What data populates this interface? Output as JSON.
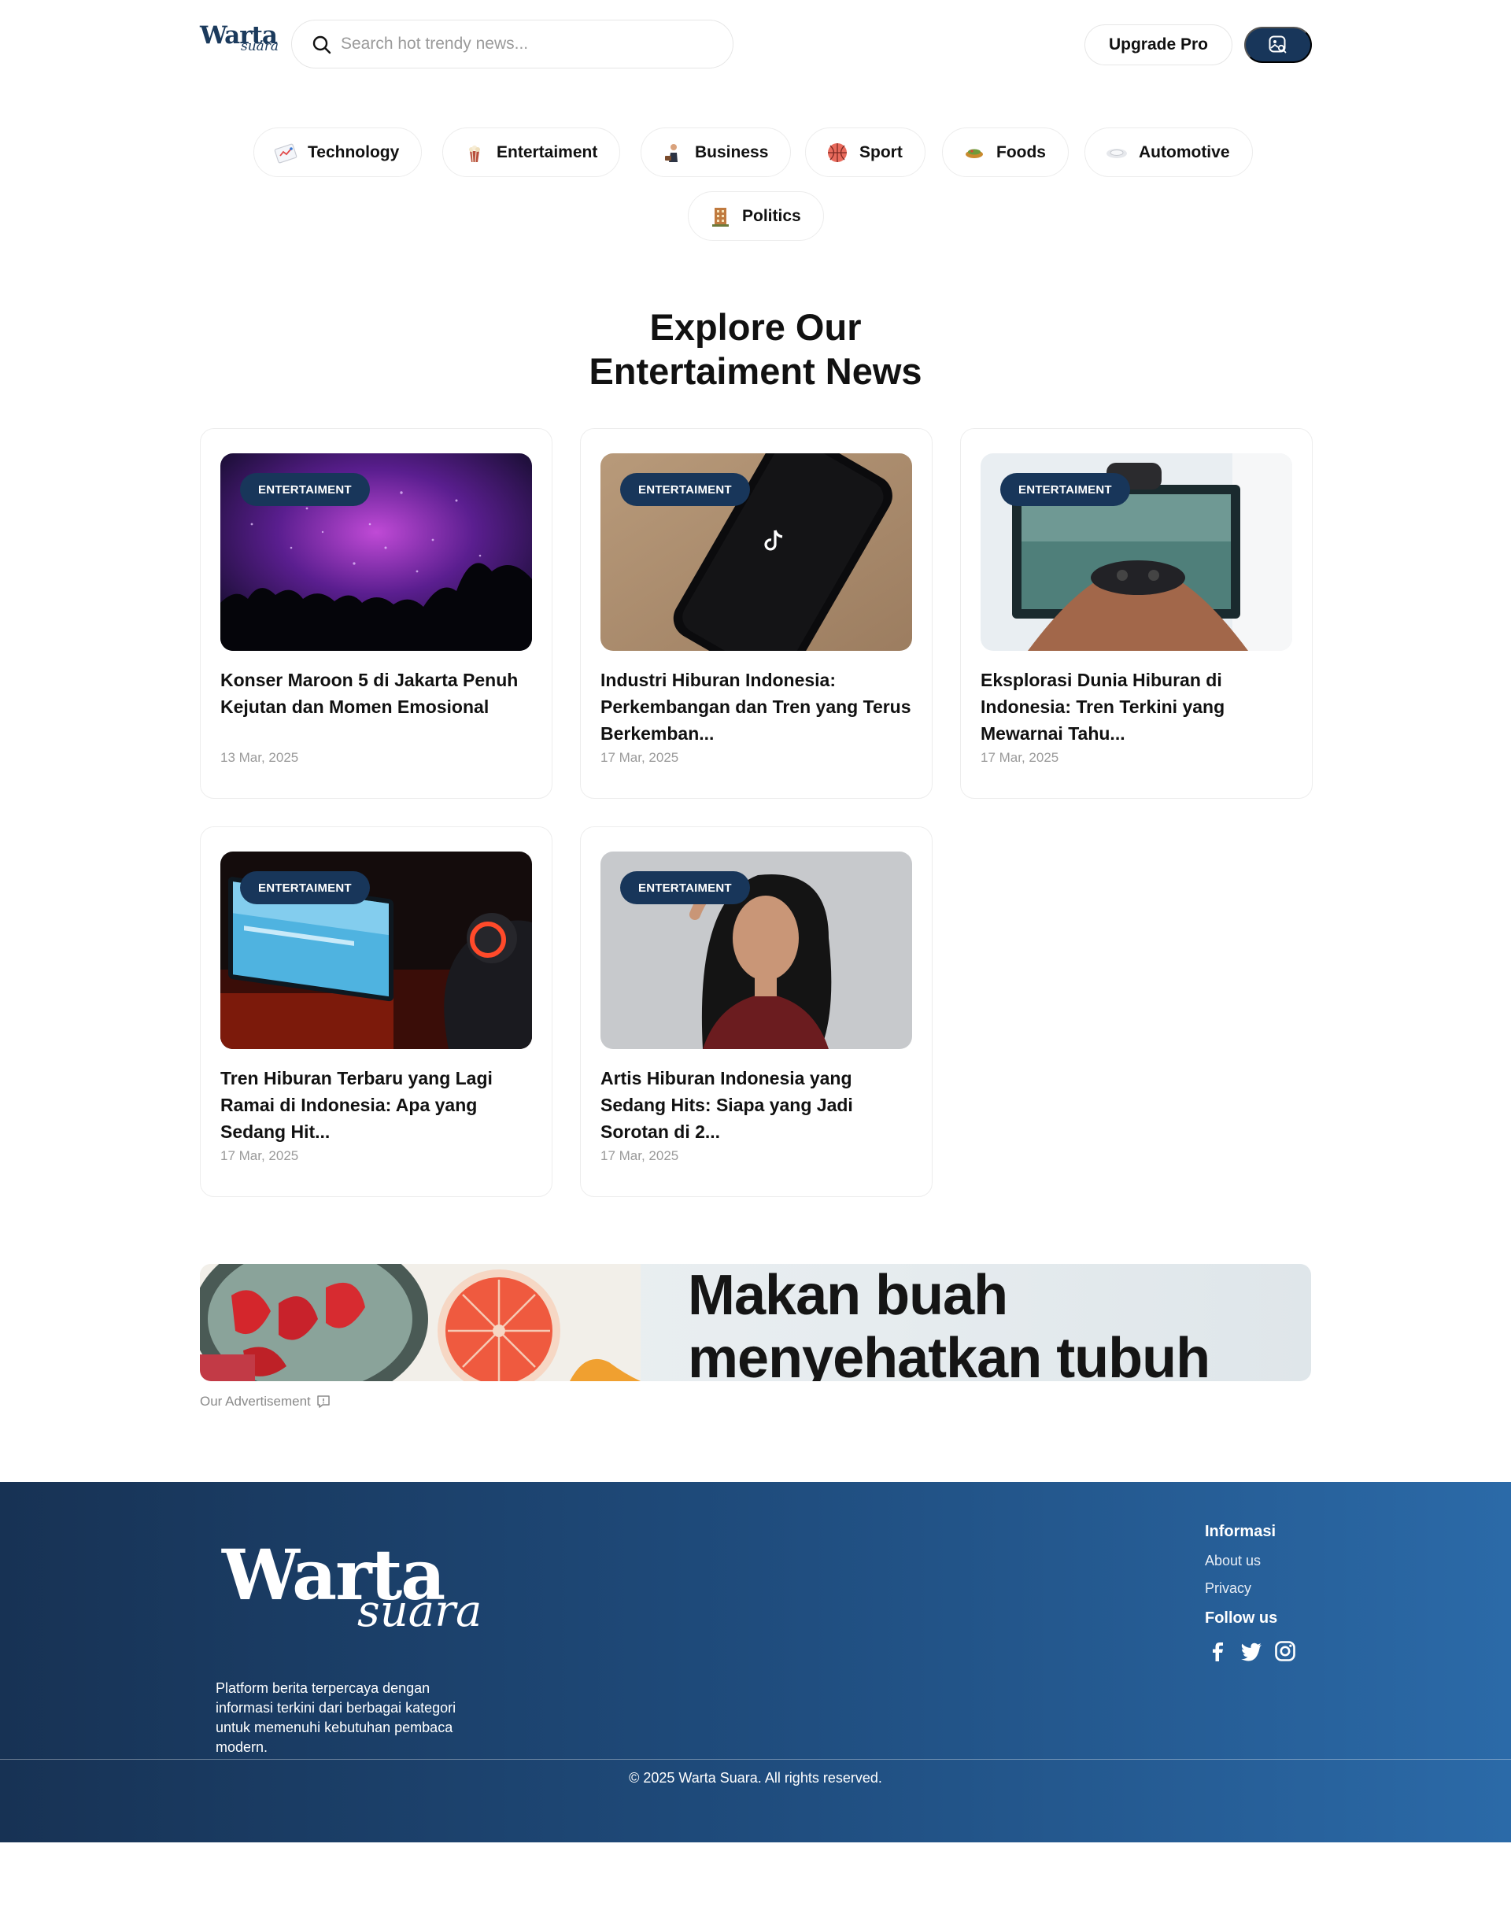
{
  "brand": {
    "logo_word": "Warta",
    "logo_script": "suara"
  },
  "search": {
    "placeholder": "Search hot trendy news..."
  },
  "header": {
    "upgrade_label": "Upgrade Pro"
  },
  "categories": [
    {
      "label": "Technology",
      "icon": "technology-icon"
    },
    {
      "label": "Entertaiment",
      "icon": "popcorn-icon"
    },
    {
      "label": "Business",
      "icon": "business-icon"
    },
    {
      "label": "Sport",
      "icon": "basketball-icon"
    },
    {
      "label": "Foods",
      "icon": "food-icon"
    },
    {
      "label": "Automotive",
      "icon": "car-icon"
    },
    {
      "label": "Politics",
      "icon": "building-icon"
    }
  ],
  "section": {
    "heading_line1": "Explore Our",
    "heading_line2": "Entertaiment News"
  },
  "articles": [
    {
      "badge": "ENTERTAIMENT",
      "title": "Konser Maroon 5 di Jakarta Penuh Kejutan dan Momen Emosional",
      "date": "13 Mar, 2025",
      "image": "concert-image"
    },
    {
      "badge": "ENTERTAIMENT",
      "title": "Industri Hiburan Indonesia: Perkembangan dan Tren yang Terus Berkemban...",
      "date": "17 Mar, 2025",
      "image": "tiktok-phone-image"
    },
    {
      "badge": "ENTERTAIMENT",
      "title": "Eksplorasi Dunia Hiburan di Indonesia: Tren Terkini yang Mewarnai Tahu...",
      "date": "17 Mar, 2025",
      "image": "game-controller-image"
    },
    {
      "badge": "ENTERTAIMENT",
      "title": "Tren Hiburan Terbaru yang Lagi Ramai di Indonesia: Apa yang Sedang Hit...",
      "date": "17 Mar, 2025",
      "image": "gamer-image"
    },
    {
      "badge": "ENTERTAIMENT",
      "title": "Artis Hiburan Indonesia yang Sedang Hits: Siapa yang Jadi Sorotan di 2...",
      "date": "17 Mar, 2025",
      "image": "actress-portrait-image"
    }
  ],
  "ad": {
    "line1": "Makan buah",
    "line2": "menyehatkan tubuh",
    "label": "Our Advertisement"
  },
  "footer": {
    "description": "Platform berita terpercaya dengan informasi terkini dari berbagai kategori untuk memenuhi kebutuhan pembaca modern.",
    "info_heading": "Informasi",
    "links": [
      "About us",
      "Privacy"
    ],
    "follow_heading": "Follow us",
    "social": [
      "facebook-icon",
      "twitter-icon",
      "instagram-icon"
    ],
    "copyright": "© 2025 Warta Suara. All rights reserved."
  },
  "colors": {
    "primary": "#18365a",
    "footer_start": "#173254",
    "footer_end": "#2b6aa8"
  }
}
